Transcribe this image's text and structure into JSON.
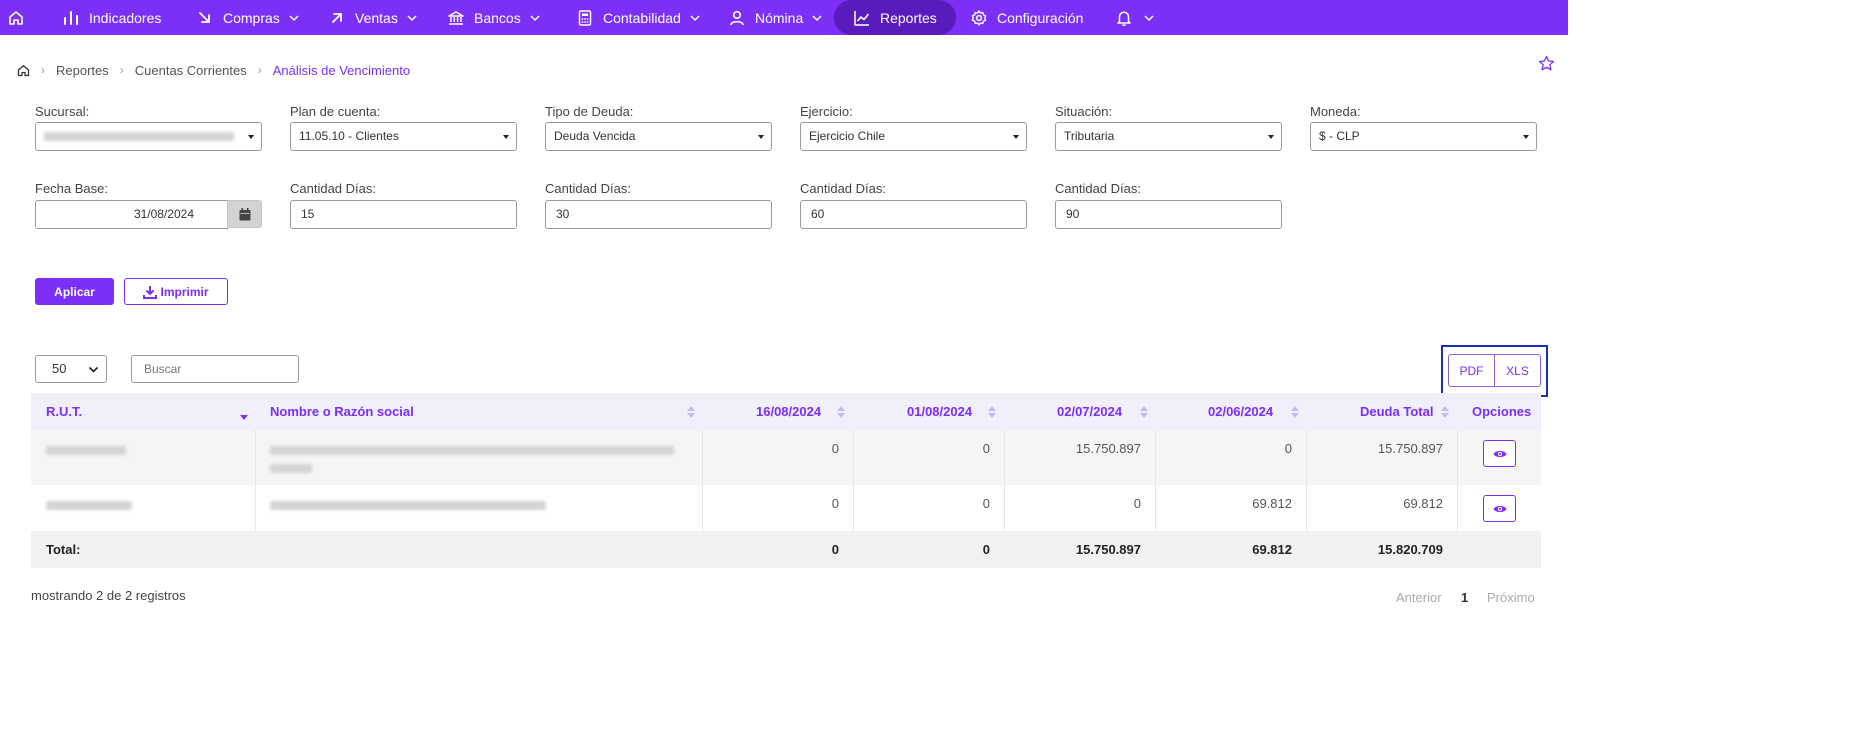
{
  "nav": {
    "items": [
      {
        "label": "Indicadores"
      },
      {
        "label": "Compras"
      },
      {
        "label": "Ventas"
      },
      {
        "label": "Bancos"
      },
      {
        "label": "Contabilidad"
      },
      {
        "label": "Nómina"
      },
      {
        "label": "Reportes"
      },
      {
        "label": "Configuración"
      }
    ],
    "active": "Reportes",
    "accent_color": "#7b2ff7"
  },
  "breadcrumb": [
    "Reportes",
    "Cuentas Corrientes",
    "Análisis de Vencimiento"
  ],
  "filters": {
    "sucursal": {
      "label": "Sucursal:"
    },
    "plan_cuenta": {
      "label": "Plan de cuenta:",
      "value": "11.05.10 - Clientes"
    },
    "tipo_deuda": {
      "label": "Tipo de Deuda:",
      "value": "Deuda Vencida"
    },
    "ejercicio": {
      "label": "Ejercicio:",
      "value": "Ejercicio Chile"
    },
    "situacion": {
      "label": "Situación:",
      "value": "Tributaria"
    },
    "moneda": {
      "label": "Moneda:",
      "value": "$ - CLP"
    },
    "fecha_base": {
      "label": "Fecha Base:",
      "value": "31/08/2024"
    },
    "dias": [
      {
        "label": "Cantidad Días:",
        "value": "15"
      },
      {
        "label": "Cantidad Días:",
        "value": "30"
      },
      {
        "label": "Cantidad Días:",
        "value": "60"
      },
      {
        "label": "Cantidad Días:",
        "value": "90"
      }
    ]
  },
  "actions": {
    "apply": "Aplicar",
    "print": "Imprimir"
  },
  "table_controls": {
    "page_length": "50",
    "search_placeholder": "Buscar",
    "export": [
      "PDF",
      "XLS"
    ]
  },
  "table": {
    "columns": [
      "R.U.T.",
      "Nombre o Razón social",
      "16/08/2024",
      "01/08/2024",
      "02/07/2024",
      "02/06/2024",
      "Deuda Total",
      "Opciones"
    ],
    "rows": [
      {
        "d1": "0",
        "d2": "0",
        "d3": "15.750.897",
        "d4": "0",
        "total": "15.750.897"
      },
      {
        "d1": "0",
        "d2": "0",
        "d3": "0",
        "d4": "69.812",
        "total": "69.812"
      }
    ],
    "totals": {
      "label": "Total:",
      "d1": "0",
      "d2": "0",
      "d3": "15.750.897",
      "d4": "69.812",
      "total": "15.820.709"
    }
  },
  "footer": {
    "info": "mostrando 2 de 2 registros",
    "prev": "Anterior",
    "page": "1",
    "next": "Próximo"
  }
}
